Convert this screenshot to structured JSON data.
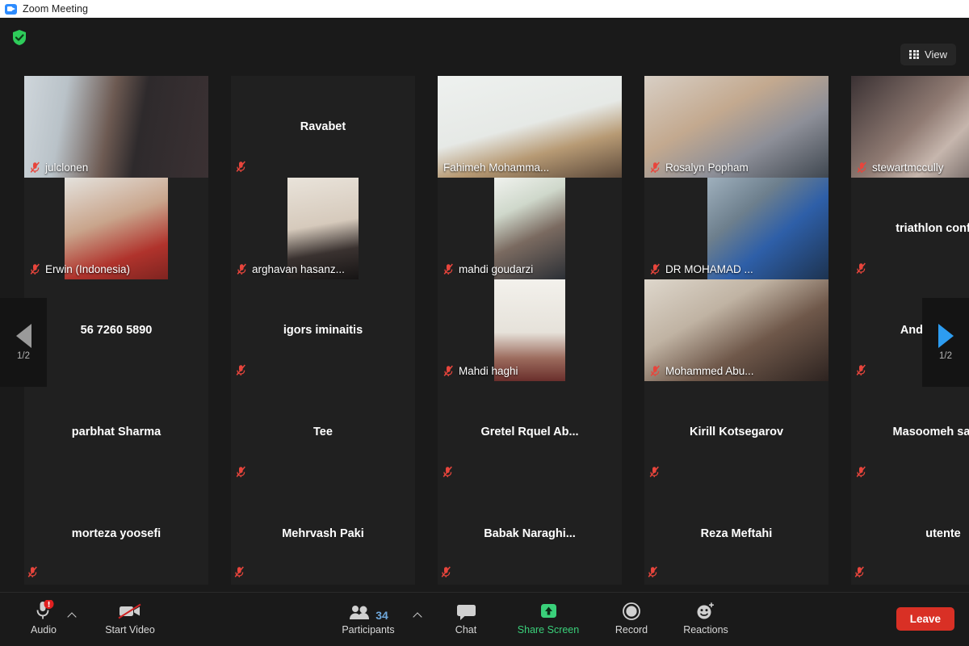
{
  "window": {
    "title": "Zoom Meeting",
    "app_icon": "zoom-camera-icon"
  },
  "topbar": {
    "security_icon": "green-shield-icon",
    "view_button": {
      "label": "View",
      "icon": "grid-view-icon"
    }
  },
  "pagination": {
    "prev": {
      "icon": "left-arrow-icon",
      "label": "1/2",
      "enabled": false
    },
    "next": {
      "icon": "right-arrow-icon",
      "label": "1/2",
      "enabled": true
    }
  },
  "gallery": {
    "active_speaker": "Fahimeh Mohamma...",
    "highlight_color": "#d9f56b",
    "rows": [
      [
        {
          "name": "julclonen",
          "video": true,
          "muted": true,
          "name_pos": "overlay",
          "crop": "full",
          "active": false
        },
        {
          "name": "Ravabet",
          "video": false,
          "muted": true,
          "name_pos": "center",
          "crop": "full",
          "active": false
        },
        {
          "name": "Fahimeh Mohamma...",
          "video": true,
          "muted": false,
          "name_pos": "overlay",
          "crop": "full",
          "active": true
        },
        {
          "name": "Rosalyn Popham",
          "video": true,
          "muted": true,
          "name_pos": "overlay",
          "crop": "full",
          "active": false
        },
        {
          "name": "stewartmccully",
          "video": true,
          "muted": true,
          "name_pos": "overlay",
          "crop": "full",
          "active": false
        }
      ],
      [
        {
          "name": "Erwin (Indonesia)",
          "video": true,
          "muted": true,
          "name_pos": "overlay",
          "crop": "mid",
          "active": false
        },
        {
          "name": "arghavan hasanz...",
          "video": true,
          "muted": true,
          "name_pos": "overlay",
          "crop": "narrow",
          "active": false
        },
        {
          "name": "mahdi goudarzi",
          "video": true,
          "muted": true,
          "name_pos": "overlay",
          "crop": "narrow",
          "active": false
        },
        {
          "name": "DR MOHAMAD ...",
          "video": true,
          "muted": true,
          "name_pos": "overlay",
          "crop": "right",
          "active": false
        },
        {
          "name": "triathlon  confer...",
          "video": false,
          "muted": true,
          "name_pos": "center",
          "crop": "full",
          "active": false
        }
      ],
      [
        {
          "name": "56 7260 5890",
          "video": false,
          "muted": true,
          "name_pos": "center",
          "crop": "full",
          "active": false
        },
        {
          "name": "igors iminaitis",
          "video": false,
          "muted": true,
          "name_pos": "center",
          "crop": "full",
          "active": false
        },
        {
          "name": "Mahdi haghi",
          "video": true,
          "muted": true,
          "name_pos": "overlay",
          "crop": "narrow",
          "active": false
        },
        {
          "name": "Mohammed Abu...",
          "video": true,
          "muted": true,
          "name_pos": "overlay",
          "crop": "full",
          "active": false
        },
        {
          "name": "Andrès Castillo",
          "video": false,
          "muted": true,
          "name_pos": "center",
          "crop": "full",
          "active": false
        }
      ],
      [
        {
          "name": "parbhat Sharma",
          "video": false,
          "muted": false,
          "name_pos": "center",
          "crop": "full",
          "active": false
        },
        {
          "name": "Tee",
          "video": false,
          "muted": true,
          "name_pos": "center",
          "crop": "full",
          "active": false
        },
        {
          "name": "Gretel Rquel Ab...",
          "video": false,
          "muted": true,
          "name_pos": "center",
          "crop": "full",
          "active": false
        },
        {
          "name": "Kirill Kotsegarov",
          "video": false,
          "muted": true,
          "name_pos": "center",
          "crop": "full",
          "active": false
        },
        {
          "name": "Masoomeh  sada...",
          "video": false,
          "muted": true,
          "name_pos": "center",
          "crop": "full",
          "active": false
        }
      ],
      [
        {
          "name": "morteza yoosefi",
          "video": false,
          "muted": true,
          "name_pos": "center",
          "crop": "full",
          "active": false
        },
        {
          "name": "Mehrvash Paki",
          "video": false,
          "muted": true,
          "name_pos": "center",
          "crop": "full",
          "active": false
        },
        {
          "name": "Babak  Naraghi...",
          "video": false,
          "muted": true,
          "name_pos": "center",
          "crop": "full",
          "active": false
        },
        {
          "name": "Reza Meftahi",
          "video": false,
          "muted": true,
          "name_pos": "center",
          "crop": "full",
          "active": false
        },
        {
          "name": "utente",
          "video": false,
          "muted": true,
          "name_pos": "center",
          "crop": "full",
          "active": false
        }
      ]
    ]
  },
  "toolbar": {
    "audio": {
      "label": "Audio",
      "icon": "microphone-warning-icon",
      "has_caret": true
    },
    "video": {
      "label": "Start Video",
      "icon": "camera-off-icon",
      "has_caret": false
    },
    "participants": {
      "label": "Participants",
      "icon": "people-icon",
      "count": "34",
      "has_caret": true
    },
    "chat": {
      "label": "Chat",
      "icon": "chat-bubble-icon",
      "has_caret": false
    },
    "share": {
      "label": "Share Screen",
      "icon": "share-screen-icon",
      "color": "#3ad07a"
    },
    "record": {
      "label": "Record",
      "icon": "record-circle-icon"
    },
    "reactions": {
      "label": "Reactions",
      "icon": "smiley-plus-icon"
    },
    "leave": {
      "label": "Leave",
      "color": "#d93025"
    }
  }
}
